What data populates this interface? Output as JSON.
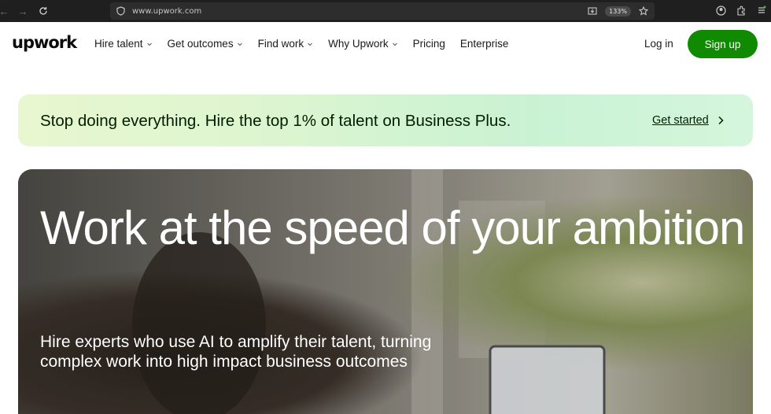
{
  "browser": {
    "url": "www.upwork.com",
    "zoom": "133%"
  },
  "header": {
    "logo": "upwork",
    "nav": [
      {
        "label": "Hire talent",
        "dropdown": true
      },
      {
        "label": "Get outcomes",
        "dropdown": true
      },
      {
        "label": "Find work",
        "dropdown": true
      },
      {
        "label": "Why Upwork",
        "dropdown": true
      },
      {
        "label": "Pricing",
        "dropdown": false
      },
      {
        "label": "Enterprise",
        "dropdown": false
      }
    ],
    "login_label": "Log in",
    "signup_label": "Sign up"
  },
  "promo": {
    "text": "Stop doing everything. Hire the top 1% of talent on Business Plus.",
    "link_label": "Get started"
  },
  "hero": {
    "title": "Work at the speed of your ambition",
    "subtitle": "Hire experts who use AI to amplify their talent, turning complex work into high impact business outcomes"
  },
  "colors": {
    "brand_green": "#108a00",
    "text_dark": "#001e00"
  }
}
